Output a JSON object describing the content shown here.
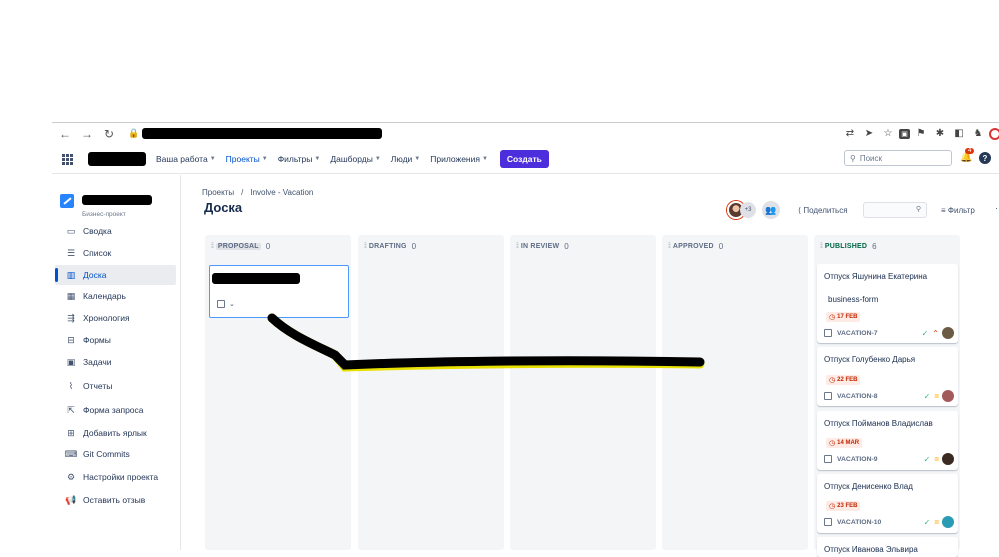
{
  "browser": {
    "nav_buttons": [
      "←",
      "→",
      "↻"
    ],
    "lock": "🔒"
  },
  "topnav": {
    "items": [
      {
        "label": "Ваша работа"
      },
      {
        "label": "Проекты"
      },
      {
        "label": "Фильтры"
      },
      {
        "label": "Дашборды"
      },
      {
        "label": "Люди"
      },
      {
        "label": "Приложения"
      }
    ],
    "create_label": "Создать",
    "search_placeholder": "Поиск",
    "notification_count": "4",
    "help": "?"
  },
  "sidebar": {
    "project_type": "Бизнес-проект",
    "items": [
      {
        "label": "Сводка",
        "icon": "summary-icon"
      },
      {
        "label": "Список",
        "icon": "list-icon"
      },
      {
        "label": "Доска",
        "icon": "board-icon"
      },
      {
        "label": "Календарь",
        "icon": "calendar-icon"
      },
      {
        "label": "Хронология",
        "icon": "timeline-icon"
      },
      {
        "label": "Формы",
        "icon": "forms-icon"
      },
      {
        "label": "Задачи",
        "icon": "tasks-icon"
      },
      {
        "label": "Отчеты",
        "icon": "reports-icon"
      },
      {
        "label": "Форма запроса",
        "icon": "request-form-icon"
      },
      {
        "label": "Добавить ярлык",
        "icon": "add-shortcut-icon"
      },
      {
        "label": "Git Commits",
        "icon": "git-icon"
      },
      {
        "label": "Настройки проекта",
        "icon": "gear-icon"
      },
      {
        "label": "Оставить отзыв",
        "icon": "megaphone-icon"
      }
    ]
  },
  "header": {
    "breadcrumb": [
      "Проекты",
      "/",
      "Involve - Vacation"
    ],
    "title": "Доска",
    "avatars_more": "+3",
    "share_label": "Поделиться",
    "filter_label": "Фильтр",
    "more": "···"
  },
  "board": {
    "columns": [
      {
        "name": "PROPOSAL",
        "count": "0"
      },
      {
        "name": "DRAFTING",
        "count": "0"
      },
      {
        "name": "IN REVIEW",
        "count": "0"
      },
      {
        "name": "APPROVED",
        "count": "0"
      },
      {
        "name": "PUBLISHED",
        "count": "6"
      }
    ],
    "cards": [
      {
        "title": "Отпуск Яшунина Екатерина",
        "form": "business-form",
        "due": "17 FEB",
        "key": "VACATION-7",
        "priority": "high"
      },
      {
        "title": "Отпуск Голубенко Дарья",
        "due": "22 FEB",
        "key": "VACATION-8",
        "priority": "medium"
      },
      {
        "title": "Отпуск Пойманов Владислав",
        "due": "14 MAR",
        "key": "VACATION-9",
        "priority": "medium"
      },
      {
        "title": "Отпуск Денисенко Влад",
        "due": "23 FEB",
        "key": "VACATION-10",
        "priority": "medium"
      },
      {
        "title": "Отпуск Иванова Эльвира"
      }
    ]
  },
  "colors": {
    "accent": "#0052cc",
    "create_button": "#4c2edd",
    "due_text": "#bf2600"
  }
}
